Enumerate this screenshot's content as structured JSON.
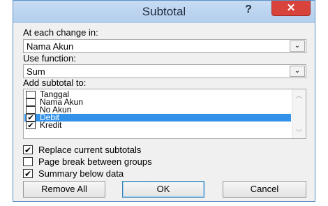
{
  "title": "Subtotal",
  "help_label": "?",
  "close_label": "✕",
  "change_label": "At each change in:",
  "change_value": "Nama Akun",
  "function_label": "Use function:",
  "function_value": "Sum",
  "addto_label": "Add subtotal to:",
  "dropdown_glyph": "⌄",
  "columns": [
    {
      "label": "Tanggal",
      "checked": false,
      "selected": false
    },
    {
      "label": "Nama Akun",
      "checked": false,
      "selected": false
    },
    {
      "label": "No Akun",
      "checked": false,
      "selected": false
    },
    {
      "label": "Debit",
      "checked": true,
      "selected": true
    },
    {
      "label": "Kredit",
      "checked": true,
      "selected": false
    }
  ],
  "options": {
    "replace": {
      "label": "Replace current subtotals",
      "checked": true
    },
    "pagebreak": {
      "label": "Page break between groups",
      "checked": false
    },
    "summary": {
      "label": "Summary below data",
      "checked": true
    }
  },
  "buttons": {
    "remove_all": "Remove All",
    "ok": "OK",
    "cancel": "Cancel"
  },
  "colors": {
    "title_bar": "#b9d2ee",
    "close_red": "#d8433b",
    "selection_blue": "#3292e8"
  }
}
